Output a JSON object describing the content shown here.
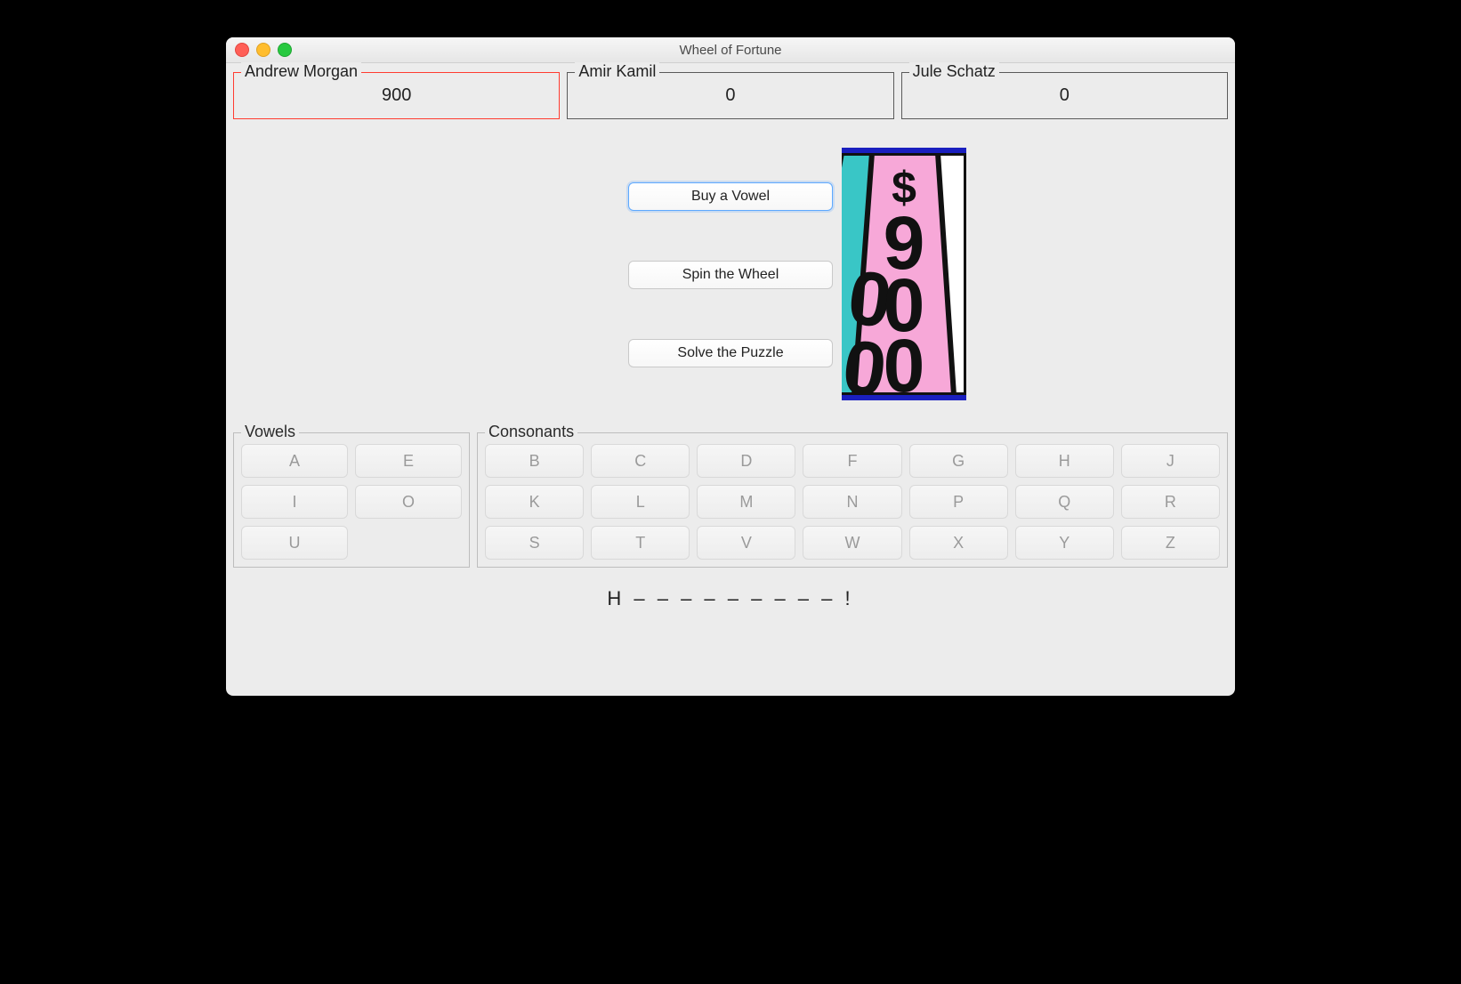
{
  "window": {
    "title": "Wheel of Fortune"
  },
  "players": [
    {
      "name": "Andrew Morgan",
      "score": "900",
      "active": true
    },
    {
      "name": "Amir Kamil",
      "score": "0",
      "active": false
    },
    {
      "name": "Jule Schatz",
      "score": "0",
      "active": false
    }
  ],
  "actions": {
    "buy_vowel": "Buy a Vowel",
    "spin_wheel": "Spin the Wheel",
    "solve": "Solve the Puzzle"
  },
  "wheel": {
    "value": "$900"
  },
  "letter_groups": {
    "vowels_label": "Vowels",
    "consonants_label": "Consonants",
    "vowels": [
      "A",
      "E",
      "I",
      "O",
      "U"
    ],
    "consonants": [
      "B",
      "C",
      "D",
      "F",
      "G",
      "H",
      "J",
      "K",
      "L",
      "M",
      "N",
      "P",
      "Q",
      "R",
      "S",
      "T",
      "V",
      "W",
      "X",
      "Y",
      "Z"
    ]
  },
  "puzzle": "H – – – –   – – – – – !"
}
